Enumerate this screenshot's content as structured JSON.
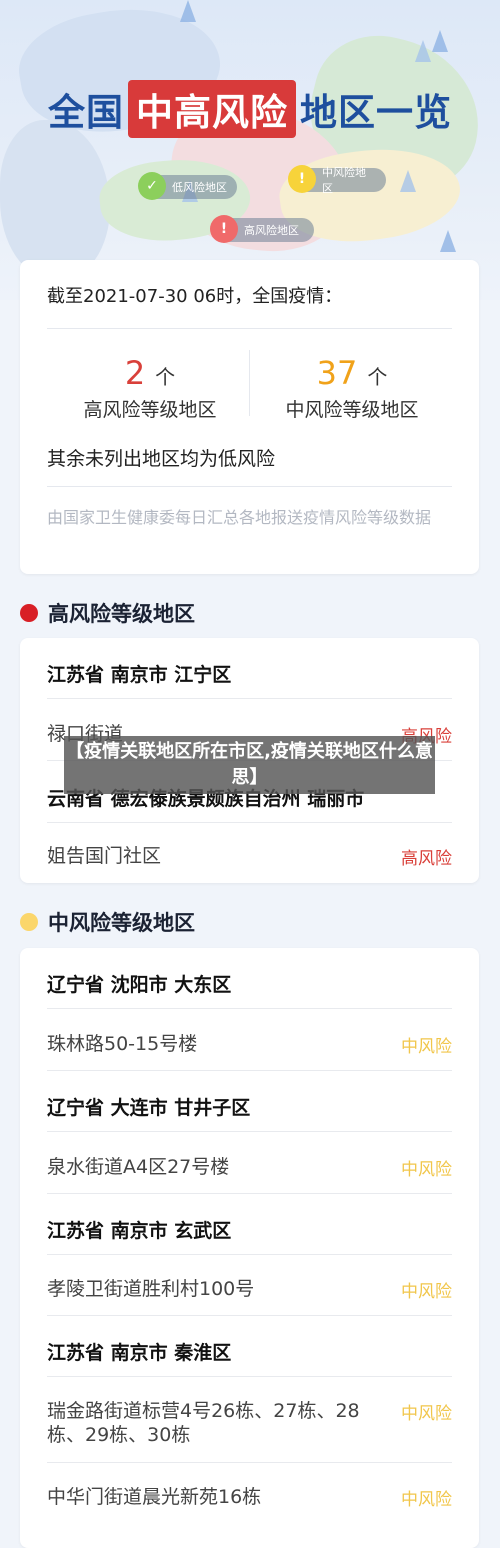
{
  "hero": {
    "title_part1": "全国",
    "title_highlight": "中高风险",
    "title_part2": "地区一览",
    "legend": {
      "low": "低风险地区",
      "mid": "中风险地区",
      "high": "高风险地区",
      "low_icon": "check-icon",
      "mid_icon": "exclamation-icon",
      "high_icon": "exclamation-icon"
    }
  },
  "summary": {
    "as_of": "截至2021-07-30 06时，全国疫情：",
    "high_count": "2",
    "high_unit": "个",
    "high_label": "高风险等级地区",
    "mid_count": "37",
    "mid_unit": "个",
    "mid_label": "中风险等级地区",
    "rest_note": "其余未列出地区均为低风险",
    "source": "由国家卫生健康委每日汇总各地报送疫情风险等级数据"
  },
  "high_section": {
    "heading": "高风险等级地区",
    "items": [
      {
        "province": "江苏省 南京市 江宁区",
        "street": "禄口街道",
        "risk": "高风险"
      },
      {
        "province": "云南省 德宏傣族景颇族自治州 瑞丽市",
        "street": "姐告国门社区",
        "risk": "高风险"
      }
    ]
  },
  "mid_section": {
    "heading": "中风险等级地区",
    "items": [
      {
        "province": "辽宁省 沈阳市 大东区",
        "street": "珠林路50-15号楼",
        "risk": "中风险"
      },
      {
        "province": "辽宁省 大连市 甘井子区",
        "street": "泉水街道A4区27号楼",
        "risk": "中风险"
      },
      {
        "province": "江苏省 南京市 玄武区",
        "street": "孝陵卫街道胜利村100号",
        "risk": "中风险"
      },
      {
        "province": "江苏省 南京市 秦淮区",
        "street": "瑞金路街道标营4号26栋、27栋、28栋、29栋、30栋",
        "risk": "中风险"
      },
      {
        "street": "中华门街道晨光新苑16栋",
        "risk": "中风险"
      }
    ]
  },
  "overlay": {
    "title": "【疫情关联地区所在市区,疫情关联地区什么意思】"
  },
  "colors": {
    "title_blue": "#1e4f9e",
    "highlight_red": "#d83a3a",
    "high_risk": "#d9403a",
    "mid_risk": "#f1c64b",
    "high_bullet": "#d81f26",
    "mid_bullet": "#fbd66b"
  }
}
